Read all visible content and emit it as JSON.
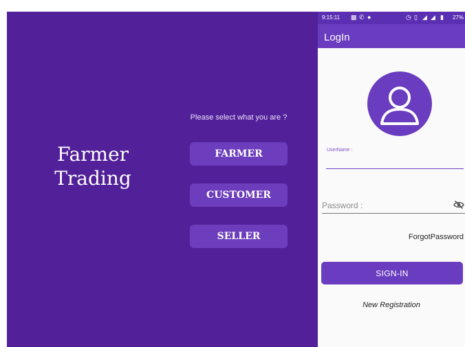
{
  "colors": {
    "left_background": "#52219A",
    "primary": "#6a3cbf",
    "status_bar": "#5b2fb2"
  },
  "welcome": {
    "app_name_line1": "Farmer",
    "app_name_line2": "Trading",
    "prompt": "Please select what you are ?",
    "roles": [
      "FARMER",
      "CUSTOMER",
      "SELLER"
    ]
  },
  "login": {
    "status_bar": {
      "time": "9:15:11",
      "battery": "27%"
    },
    "title": "LogIn",
    "avatar_icon": "person-icon",
    "username_label": "UserName :",
    "username_value": "",
    "password_placeholder": "Password :",
    "password_value": "",
    "password_toggle_icon": "eye-off-icon",
    "forgot_password": "ForgotPassword",
    "sign_in": "SIGN-IN",
    "new_registration": "New Registration"
  }
}
